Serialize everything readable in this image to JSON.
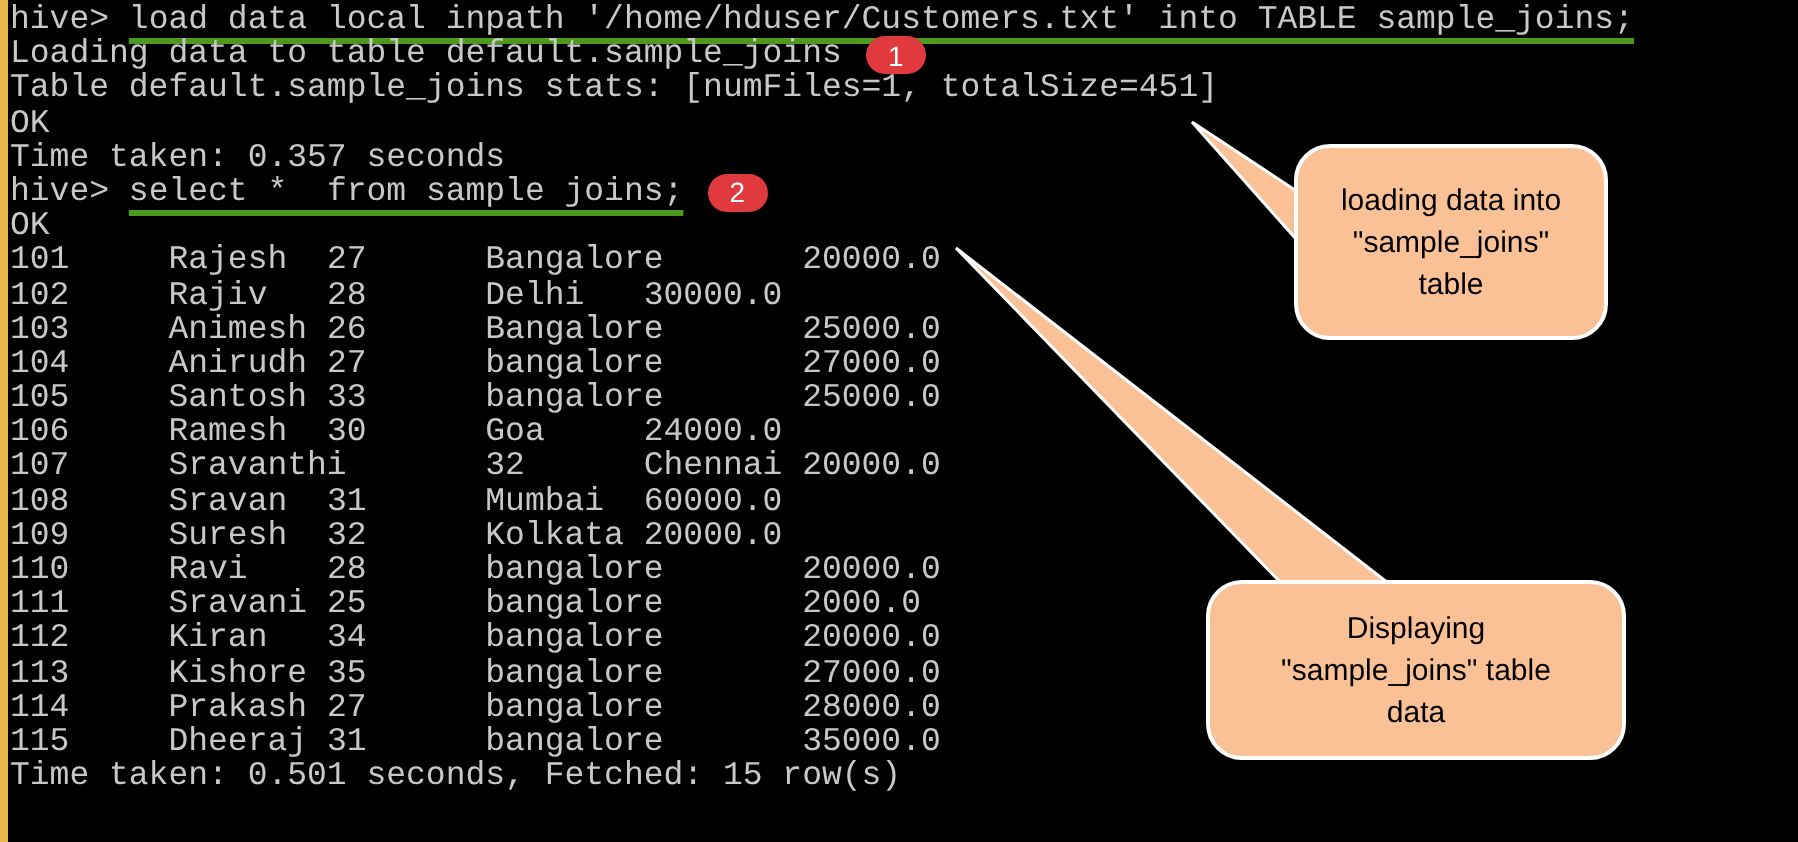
{
  "terminal": {
    "lines": [
      {
        "kind": "command",
        "prompt": "hive>",
        "command": "load data local inpath '/home/hduser/Customers.txt' into TABLE sample_joins;"
      },
      {
        "kind": "output",
        "text": "Loading data to table default.sample_joins",
        "badge": "1"
      },
      {
        "kind": "output",
        "text": "Table default.sample_joins stats: [numFiles=1, totalSize=451]"
      },
      {
        "kind": "output",
        "text": "OK"
      },
      {
        "kind": "output",
        "text": "Time taken: 0.357 seconds"
      },
      {
        "kind": "command",
        "prompt": "hive>",
        "command": "select *  from sample joins;",
        "badge": "2"
      },
      {
        "kind": "output",
        "text": "OK"
      },
      {
        "kind": "row",
        "cells": [
          "101",
          "Rajesh",
          "27",
          "Bangalore",
          "20000.0"
        ]
      },
      {
        "kind": "row",
        "cells": [
          "102",
          "Rajiv",
          "28",
          "Delhi",
          "30000.0"
        ]
      },
      {
        "kind": "row",
        "cells": [
          "103",
          "Animesh",
          "26",
          "Bangalore",
          "25000.0"
        ]
      },
      {
        "kind": "row",
        "cells": [
          "104",
          "Anirudh",
          "27",
          "bangalore",
          "27000.0"
        ]
      },
      {
        "kind": "row",
        "cells": [
          "105",
          "Santosh",
          "33",
          "bangalore",
          "25000.0"
        ]
      },
      {
        "kind": "row",
        "cells": [
          "106",
          "Ramesh",
          "30",
          "Goa",
          "24000.0"
        ]
      },
      {
        "kind": "row",
        "cells": [
          "107",
          "Sravanthi",
          "32",
          "Chennai",
          "20000.0"
        ]
      },
      {
        "kind": "row",
        "cells": [
          "108",
          "Sravan",
          "31",
          "Mumbai",
          "60000.0"
        ]
      },
      {
        "kind": "row",
        "cells": [
          "109",
          "Suresh",
          "32",
          "Kolkata",
          "20000.0"
        ]
      },
      {
        "kind": "row",
        "cells": [
          "110",
          "Ravi",
          "28",
          "bangalore",
          "20000.0"
        ]
      },
      {
        "kind": "row",
        "cells": [
          "111",
          "Sravani",
          "25",
          "bangalore",
          "2000.0"
        ]
      },
      {
        "kind": "row",
        "cells": [
          "112",
          "Kiran",
          "34",
          "bangalore",
          "20000.0"
        ]
      },
      {
        "kind": "row",
        "cells": [
          "113",
          "Kishore",
          "35",
          "bangalore",
          "27000.0"
        ]
      },
      {
        "kind": "row",
        "cells": [
          "114",
          "Prakash",
          "27",
          "bangalore",
          "28000.0"
        ]
      },
      {
        "kind": "row",
        "cells": [
          "115",
          "Dheeraj",
          "31",
          "bangalore",
          "35000.0"
        ]
      },
      {
        "kind": "output",
        "text": "Time taken: 0.501 seconds, Fetched: 15 row(s)"
      }
    ]
  },
  "callouts": [
    {
      "lines": [
        "loading data into",
        "\"sample_joins\"",
        "table"
      ]
    },
    {
      "lines": [
        "Displaying",
        "\"sample_joins\" table",
        "data"
      ]
    }
  ]
}
